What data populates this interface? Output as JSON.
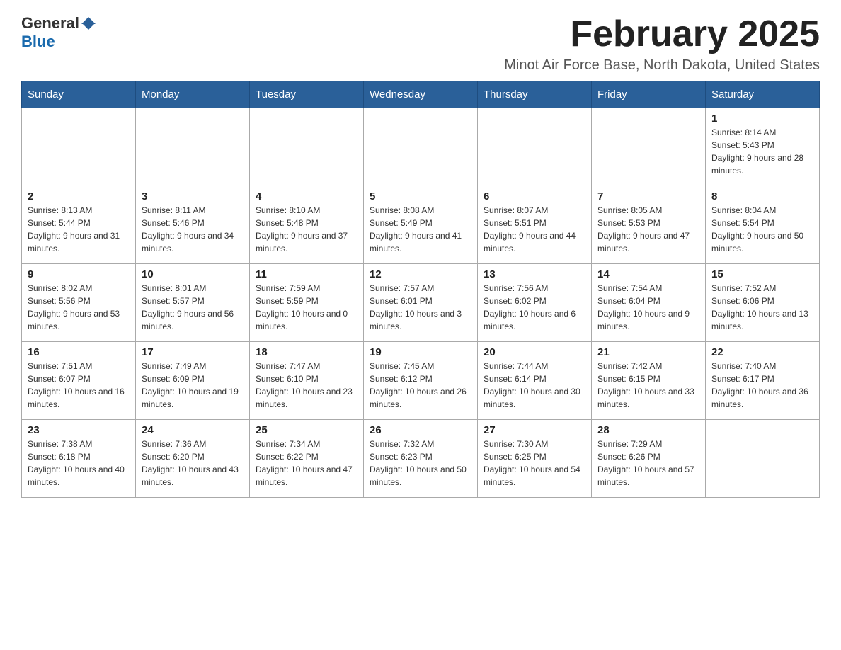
{
  "header": {
    "logo": {
      "general": "General",
      "blue": "Blue"
    },
    "title": "February 2025",
    "location": "Minot Air Force Base, North Dakota, United States"
  },
  "calendar": {
    "days_of_week": [
      "Sunday",
      "Monday",
      "Tuesday",
      "Wednesday",
      "Thursday",
      "Friday",
      "Saturday"
    ],
    "weeks": [
      {
        "days": [
          {
            "date": "",
            "info": ""
          },
          {
            "date": "",
            "info": ""
          },
          {
            "date": "",
            "info": ""
          },
          {
            "date": "",
            "info": ""
          },
          {
            "date": "",
            "info": ""
          },
          {
            "date": "",
            "info": ""
          },
          {
            "date": "1",
            "info": "Sunrise: 8:14 AM\nSunset: 5:43 PM\nDaylight: 9 hours and 28 minutes."
          }
        ]
      },
      {
        "days": [
          {
            "date": "2",
            "info": "Sunrise: 8:13 AM\nSunset: 5:44 PM\nDaylight: 9 hours and 31 minutes."
          },
          {
            "date": "3",
            "info": "Sunrise: 8:11 AM\nSunset: 5:46 PM\nDaylight: 9 hours and 34 minutes."
          },
          {
            "date": "4",
            "info": "Sunrise: 8:10 AM\nSunset: 5:48 PM\nDaylight: 9 hours and 37 minutes."
          },
          {
            "date": "5",
            "info": "Sunrise: 8:08 AM\nSunset: 5:49 PM\nDaylight: 9 hours and 41 minutes."
          },
          {
            "date": "6",
            "info": "Sunrise: 8:07 AM\nSunset: 5:51 PM\nDaylight: 9 hours and 44 minutes."
          },
          {
            "date": "7",
            "info": "Sunrise: 8:05 AM\nSunset: 5:53 PM\nDaylight: 9 hours and 47 minutes."
          },
          {
            "date": "8",
            "info": "Sunrise: 8:04 AM\nSunset: 5:54 PM\nDaylight: 9 hours and 50 minutes."
          }
        ]
      },
      {
        "days": [
          {
            "date": "9",
            "info": "Sunrise: 8:02 AM\nSunset: 5:56 PM\nDaylight: 9 hours and 53 minutes."
          },
          {
            "date": "10",
            "info": "Sunrise: 8:01 AM\nSunset: 5:57 PM\nDaylight: 9 hours and 56 minutes."
          },
          {
            "date": "11",
            "info": "Sunrise: 7:59 AM\nSunset: 5:59 PM\nDaylight: 10 hours and 0 minutes."
          },
          {
            "date": "12",
            "info": "Sunrise: 7:57 AM\nSunset: 6:01 PM\nDaylight: 10 hours and 3 minutes."
          },
          {
            "date": "13",
            "info": "Sunrise: 7:56 AM\nSunset: 6:02 PM\nDaylight: 10 hours and 6 minutes."
          },
          {
            "date": "14",
            "info": "Sunrise: 7:54 AM\nSunset: 6:04 PM\nDaylight: 10 hours and 9 minutes."
          },
          {
            "date": "15",
            "info": "Sunrise: 7:52 AM\nSunset: 6:06 PM\nDaylight: 10 hours and 13 minutes."
          }
        ]
      },
      {
        "days": [
          {
            "date": "16",
            "info": "Sunrise: 7:51 AM\nSunset: 6:07 PM\nDaylight: 10 hours and 16 minutes."
          },
          {
            "date": "17",
            "info": "Sunrise: 7:49 AM\nSunset: 6:09 PM\nDaylight: 10 hours and 19 minutes."
          },
          {
            "date": "18",
            "info": "Sunrise: 7:47 AM\nSunset: 6:10 PM\nDaylight: 10 hours and 23 minutes."
          },
          {
            "date": "19",
            "info": "Sunrise: 7:45 AM\nSunset: 6:12 PM\nDaylight: 10 hours and 26 minutes."
          },
          {
            "date": "20",
            "info": "Sunrise: 7:44 AM\nSunset: 6:14 PM\nDaylight: 10 hours and 30 minutes."
          },
          {
            "date": "21",
            "info": "Sunrise: 7:42 AM\nSunset: 6:15 PM\nDaylight: 10 hours and 33 minutes."
          },
          {
            "date": "22",
            "info": "Sunrise: 7:40 AM\nSunset: 6:17 PM\nDaylight: 10 hours and 36 minutes."
          }
        ]
      },
      {
        "days": [
          {
            "date": "23",
            "info": "Sunrise: 7:38 AM\nSunset: 6:18 PM\nDaylight: 10 hours and 40 minutes."
          },
          {
            "date": "24",
            "info": "Sunrise: 7:36 AM\nSunset: 6:20 PM\nDaylight: 10 hours and 43 minutes."
          },
          {
            "date": "25",
            "info": "Sunrise: 7:34 AM\nSunset: 6:22 PM\nDaylight: 10 hours and 47 minutes."
          },
          {
            "date": "26",
            "info": "Sunrise: 7:32 AM\nSunset: 6:23 PM\nDaylight: 10 hours and 50 minutes."
          },
          {
            "date": "27",
            "info": "Sunrise: 7:30 AM\nSunset: 6:25 PM\nDaylight: 10 hours and 54 minutes."
          },
          {
            "date": "28",
            "info": "Sunrise: 7:29 AM\nSunset: 6:26 PM\nDaylight: 10 hours and 57 minutes."
          },
          {
            "date": "",
            "info": ""
          }
        ]
      }
    ]
  }
}
